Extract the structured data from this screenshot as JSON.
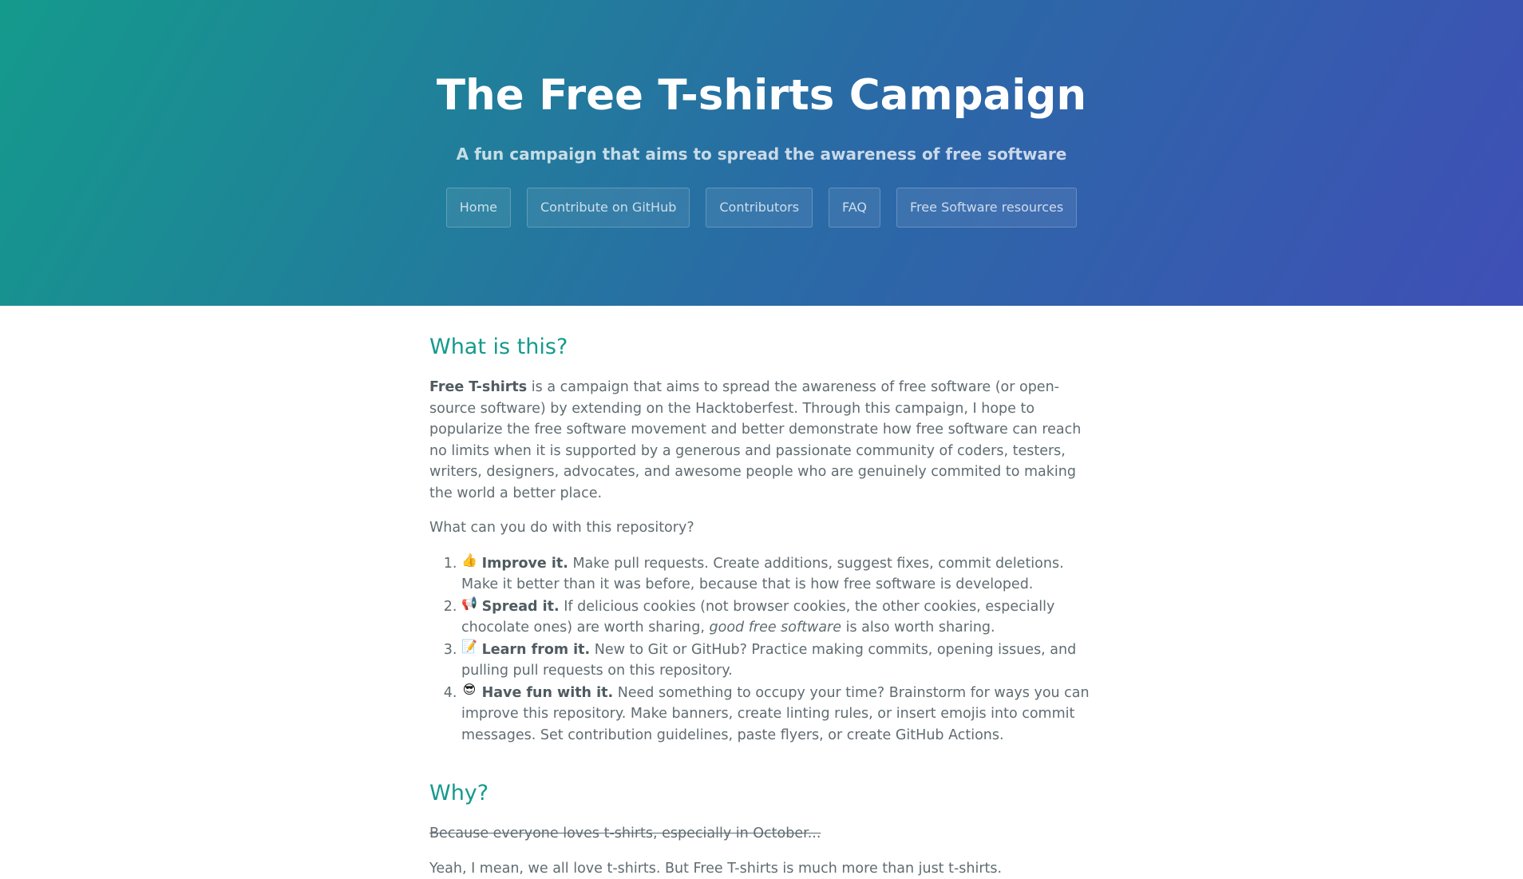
{
  "header": {
    "title": "The Free T-shirts Campaign",
    "tagline": "A fun campaign that aims to spread the awareness of free software"
  },
  "nav": {
    "home": "Home",
    "contribute": "Contribute on GitHub",
    "contributors": "Contributors",
    "faq": "FAQ",
    "resources": "Free Software resources"
  },
  "what": {
    "heading": "What is this?",
    "intro_bold": "Free T-shirts",
    "intro_rest": " is a campaign that aims to spread the awareness of free software (or open-source software) by extending on the Hacktoberfest. Through this campaign, I hope to popularize the free software movement and better demonstrate how free software can reach no limits when it is supported by a generous and passionate community of coders, testers, writers, designers, advocates, and awesome people who are genuinely commited to making the world a better place.",
    "question": "What can you do with this repository?",
    "items": [
      {
        "icon": "thumbs-up",
        "bold": "Improve it.",
        "text": " Make pull requests. Create additions, suggest fixes, commit deletions. Make it better than it was before, because that is how free software is developed."
      },
      {
        "icon": "megaphone",
        "bold": "Spread it.",
        "text": " If delicious cookies (not browser cookies, the other cookies, especially chocolate ones) are worth sharing, ",
        "italic": "good free software",
        "text_after": " is also worth sharing."
      },
      {
        "icon": "memo",
        "bold": "Learn from it.",
        "text": " New to Git or GitHub? Practice making commits, opening issues, and pulling pull requests on this repository."
      },
      {
        "icon": "sunglasses-face",
        "bold": "Have fun with it.",
        "text": " Need something to occupy your time? Brainstorm for ways you can improve this repository. Make banners, create linting rules, or insert emojis into commit messages. Set contribution guidelines, paste flyers, or create GitHub Actions."
      }
    ]
  },
  "why": {
    "heading": "Why?",
    "strikethrough": "Because everyone loves t-shirts, especially in October...",
    "answer": "Yeah, I mean, we all love t-shirts. But Free T-shirts is much more than just t-shirts."
  },
  "colors": {
    "gradient_start": "#149a8c",
    "gradient_end": "#3f4fb6",
    "heading": "#159a8c",
    "body_text": "#606c71"
  }
}
